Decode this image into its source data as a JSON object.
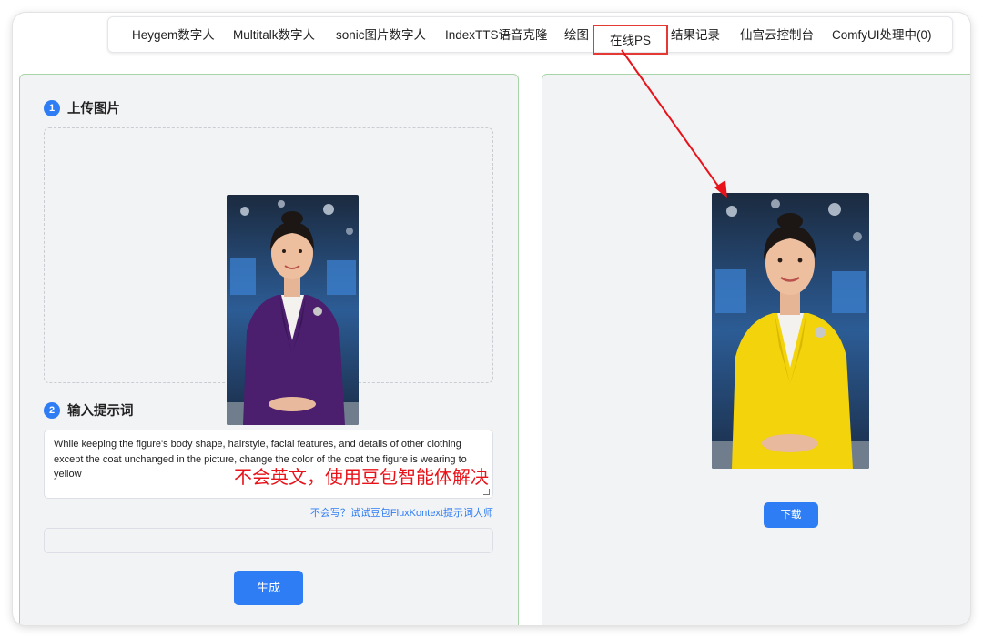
{
  "nav": {
    "items": [
      "Heygem数字人",
      "Multitalk数字人",
      "sonic图片数字人",
      "IndexTTS语音克隆",
      "绘图",
      "在线PS",
      "结果记录",
      "仙宫云控制台",
      "ComfyUI处理中(0)"
    ],
    "active": "在线PS"
  },
  "left": {
    "step1": {
      "num": "1",
      "title": "上传图片"
    },
    "step2": {
      "num": "2",
      "title": "输入提示词"
    },
    "prompt_text": "While keeping the figure's body shape, hairstyle, facial features, and details of other clothing except the coat unchanged in the picture, change the color of the coat the figure is wearing to yellow",
    "helper_link": "不会写？试试豆包FluxKontext提示词大师",
    "generate_label": "生成"
  },
  "annotation": "不会英文，使用豆包智能体解决",
  "right": {
    "download_label": "下载"
  },
  "colors": {
    "accent": "#2f7df4",
    "annotation_red": "#e8131a",
    "panel_border": "#a8d5a8",
    "coat_original": "#4b1f6e",
    "coat_result": "#f2d30c"
  }
}
